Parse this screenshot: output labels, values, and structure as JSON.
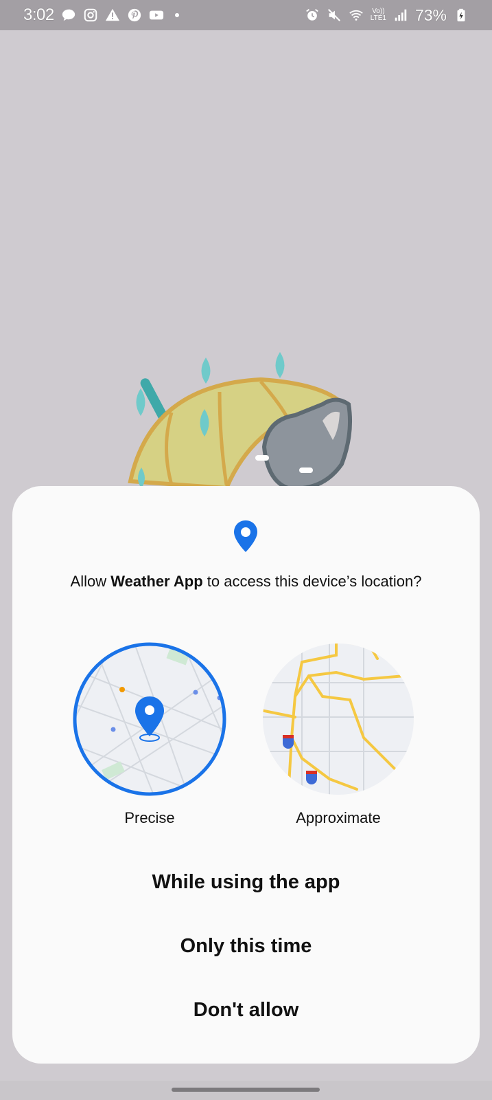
{
  "status_bar": {
    "time": "3:02",
    "left_icons": [
      "chat-icon",
      "instagram-icon",
      "warning-icon",
      "pinterest-icon",
      "youtube-icon"
    ],
    "right_icons": [
      "alarm-icon",
      "mute-icon",
      "wifi-icon",
      "signal-icon",
      "battery-charging-icon"
    ],
    "volte_line1": "Vo))",
    "volte_line2": "LTE1",
    "battery": "73%"
  },
  "dialog": {
    "title_prefix": "Allow ",
    "app_name": "Weather App",
    "title_suffix": " to access this device’s location?",
    "options": [
      {
        "label": "Precise",
        "selected": true
      },
      {
        "label": "Approximate",
        "selected": false
      }
    ],
    "actions": [
      "While using the app",
      "Only this time",
      "Don't allow"
    ]
  },
  "colors": {
    "accent": "#1a73e8",
    "dialog_bg": "#fafafa",
    "scrim": "#cfcbd0",
    "road_yellow": "#f5c842"
  }
}
